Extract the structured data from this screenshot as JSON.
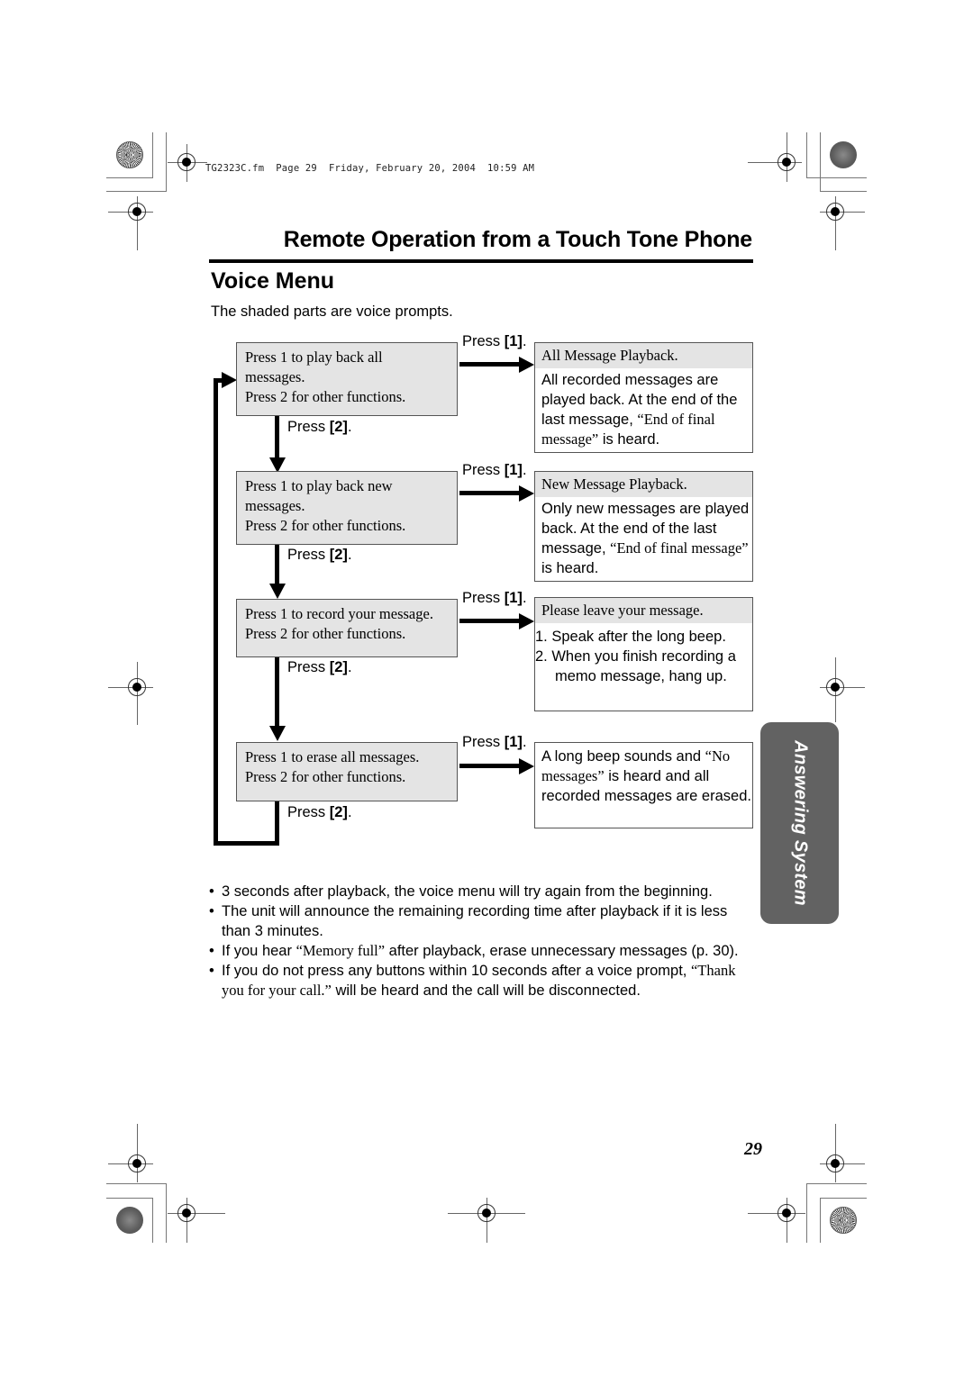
{
  "print_stamp": "TG2323C.fm  Page 29  Friday, February 20, 2004  10:59 AM",
  "section_title": "Remote Operation from a Touch Tone Phone",
  "page_title": "Voice Menu",
  "intro": "The shaded parts are voice prompts.",
  "press1_label": "Press ",
  "press1_key": "[1]",
  "press2_label": "Press ",
  "press2_key": "[2]",
  "press_suffix": ".",
  "flow": [
    {
      "prompt": [
        "Press 1 to play back all",
        "messages.",
        "Press 2 for other functions."
      ],
      "result_heading": "All Message Playback.",
      "result_body": {
        "pre": "All recorded messages are played back. At the end of the last message, ",
        "quote": "“End of final message”",
        "post": " is heard."
      }
    },
    {
      "prompt": [
        "Press 1 to play back new",
        "messages.",
        "Press 2 for other functions."
      ],
      "result_heading": "New Message Playback.",
      "result_body": {
        "pre": "Only new messages are played back. At the end of the last message, ",
        "quote": "“End of final message”",
        "post": " is heard."
      }
    },
    {
      "prompt": [
        "Press 1 to record your message.",
        "Press 2 for other functions."
      ],
      "result_heading": "Please leave your message.",
      "result_steps": [
        "1. Speak after the long beep.",
        "2. When you finish recording a memo message, hang up."
      ]
    },
    {
      "prompt": [
        "Press 1 to erase all messages.",
        "Press 2 for other functions."
      ],
      "result_body": {
        "pre": "A long beep sounds and ",
        "quote": "“No messages”",
        "post": " is heard and all recorded messages are erased."
      }
    }
  ],
  "side_tab": "Answering System",
  "notes": [
    {
      "text": "3 seconds after playback, the voice menu will try again from the beginning."
    },
    {
      "text": "The unit will announce the remaining recording time after playback if it is less than 3 minutes."
    },
    {
      "pre": "If you hear ",
      "quote": "“Memory full”",
      "post": " after playback, erase unnecessary messages (p. 30)."
    },
    {
      "pre": "If you do not press any buttons within 10 seconds after a voice prompt, ",
      "quote": "“Thank you for your call.”",
      "post": " will be heard and the call will be disconnected."
    }
  ],
  "bullet": "•",
  "page_number": "29"
}
